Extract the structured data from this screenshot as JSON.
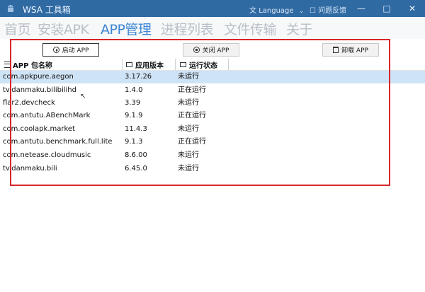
{
  "window": {
    "title": "WSA 工具箱",
    "language_label": "Language",
    "feedback_label": "问题反馈",
    "minimize": "—",
    "maximize": "□",
    "close": "✕"
  },
  "nav": {
    "tabs": [
      {
        "label": "首页"
      },
      {
        "label": "安装APK"
      },
      {
        "label": "APP管理"
      },
      {
        "label": "进程列表"
      },
      {
        "label": "文件传输"
      },
      {
        "label": "关于"
      }
    ],
    "active_index": 2
  },
  "toolbar": {
    "start_label": "启动 APP",
    "close_label": "关闭 APP",
    "uninstall_label": "卸载 APP"
  },
  "table": {
    "columns": [
      "APP 包名称",
      "应用版本",
      "运行状态"
    ],
    "rows": [
      {
        "package": "com.apkpure.aegon",
        "version": "3.17.26",
        "status": "未运行"
      },
      {
        "package": "tv.danmaku.bilibilihd",
        "version": "1.4.0",
        "status": "正在运行"
      },
      {
        "package": "flar2.devcheck",
        "version": "3.39",
        "status": "未运行"
      },
      {
        "package": "com.antutu.ABenchMark",
        "version": "9.1.9",
        "status": "正在运行"
      },
      {
        "package": "com.coolapk.market",
        "version": "11.4.3",
        "status": "未运行"
      },
      {
        "package": "com.antutu.benchmark.full.lite",
        "version": "9.1.3",
        "status": "正在运行"
      },
      {
        "package": "com.netease.cloudmusic",
        "version": "8.6.00",
        "status": "未运行"
      },
      {
        "package": "tv.danmaku.bili",
        "version": "6.45.0",
        "status": "未运行"
      }
    ],
    "selected_index": 0
  },
  "colors": {
    "titlebar": "#2f6aa3",
    "active_tab": "#3b86d4",
    "inactive_tab": "#b9c0c7",
    "selection": "#cfe3f6",
    "highlight_border": "#d9262b"
  }
}
